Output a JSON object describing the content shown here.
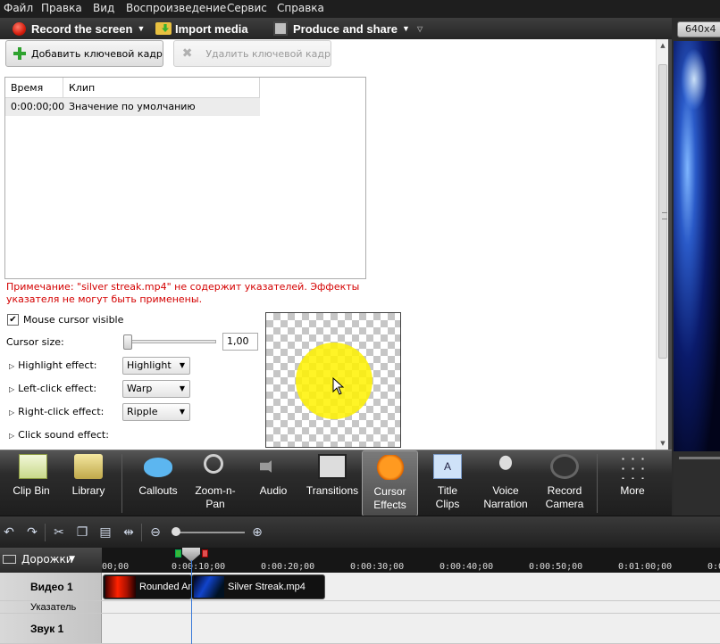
{
  "menubar": {
    "items": [
      "Файл",
      "Правка",
      "Вид",
      "Воспроизведение",
      "Сервис",
      "Справка"
    ]
  },
  "toolbar": {
    "record": "Record the screen",
    "import": "Import media",
    "produce": "Produce and share"
  },
  "preview": {
    "size_label": "640x4"
  },
  "keyframes": {
    "add_button": "Добавить ключевой кадр",
    "remove_button": "Удалить ключевой кадр",
    "columns": [
      "Время",
      "Клип"
    ],
    "rows": [
      {
        "time": "0:00:00;00",
        "clip": "Значение по умолчанию"
      }
    ]
  },
  "note": "Примечание: \"silver streak.mp4\" не содержит указателей. Эффекты указателя не могут быть применены.",
  "cursor": {
    "visible_label": "Mouse cursor visible",
    "visible_checked": true,
    "size_label": "Cursor size:",
    "size_value": "1,00",
    "highlight_label": "Highlight effect:",
    "highlight_value": "Highlight",
    "left_click_label": "Left-click effect:",
    "left_click_value": "Warp",
    "right_click_label": "Right-click effect:",
    "right_click_value": "Ripple",
    "sound_label": "Click sound effect:",
    "highlight_color": "#fff200"
  },
  "tabs": [
    {
      "id": "clip-bin",
      "label1": "Clip Bin",
      "label2": "",
      "icon": "clip-bin-icon"
    },
    {
      "id": "library",
      "label1": "Library",
      "label2": "",
      "icon": "library-icon"
    },
    {
      "id": "callouts",
      "label1": "Callouts",
      "label2": "",
      "icon": "callouts-icon"
    },
    {
      "id": "zoom-n-pan",
      "label1": "Zoom-n-",
      "label2": "Pan",
      "icon": "zoom-icon"
    },
    {
      "id": "audio",
      "label1": "Audio",
      "label2": "",
      "icon": "audio-icon"
    },
    {
      "id": "transitions",
      "label1": "Transitions",
      "label2": "",
      "icon": "transitions-icon"
    },
    {
      "id": "cursor-effects",
      "label1": "Cursor",
      "label2": "Effects",
      "icon": "cursor-effects-icon",
      "active": true
    },
    {
      "id": "title-clips",
      "label1": "Title",
      "label2": "Clips",
      "icon": "title-clips-icon"
    },
    {
      "id": "voice-narration",
      "label1": "Voice",
      "label2": "Narration",
      "icon": "microphone-icon"
    },
    {
      "id": "record-camera",
      "label1": "Record",
      "label2": "Camera",
      "icon": "camera-icon"
    },
    {
      "id": "more",
      "label1": "More",
      "label2": "",
      "icon": "more-icon"
    }
  ],
  "timeline": {
    "tracks_dropdown": "Дорожки",
    "ruler": [
      "00;00",
      "0:00:10;00",
      "0:00:20;00",
      "0:00:30;00",
      "0:00:40;00",
      "0:00:50;00",
      "0:01:00;00",
      "0:0"
    ],
    "video_track": "Видео 1",
    "pointer_track": "Указатель",
    "audio_track": "Звук 1",
    "clips": [
      {
        "name": "Rounded An"
      },
      {
        "name": "Silver Streak.mp4"
      }
    ]
  },
  "colors": {
    "accent": "#3a7ad8",
    "note_text": "#d40000",
    "record": "#d41c0c"
  }
}
